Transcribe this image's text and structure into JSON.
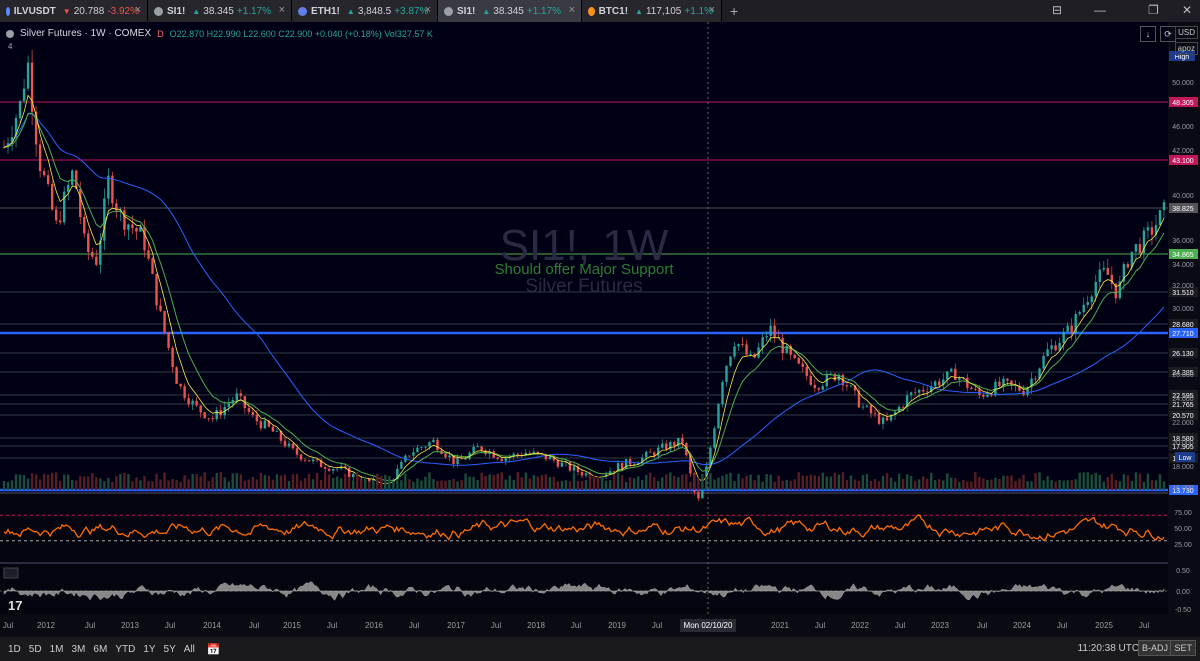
{
  "tabs": [
    {
      "symbol": "ILVUSDT",
      "price": "20.788",
      "change": "-3.92%",
      "dir": "neg",
      "icon_color": "#5a8cff",
      "icon": "ilv-coin-icon"
    },
    {
      "symbol": "SI1!",
      "price": "38.345",
      "change": "+1.17%",
      "dir": "pos",
      "icon_color": "#9aa0a6",
      "icon": "silver-icon"
    },
    {
      "symbol": "ETH1!",
      "price": "3,848.5",
      "change": "+3.87%",
      "dir": "pos",
      "icon_color": "#627eea",
      "icon": "ethereum-icon"
    },
    {
      "symbol": "SI1!",
      "price": "38.345",
      "change": "+1.17%",
      "dir": "pos",
      "icon_color": "#9aa0a6",
      "icon": "silver-icon",
      "active": true
    },
    {
      "symbol": "BTC1!",
      "price": "117,105",
      "change": "+1.1%",
      "dir": "pos",
      "icon_color": "#f7931a",
      "icon": "bitcoin-icon"
    }
  ],
  "legend": {
    "title": "Silver Futures · 1W · COMEX",
    "d": "D",
    "ohlc": "O22.870 H22.990 L22.600 C22.900 +0.040 (+0.18%) Vol327.57 K"
  },
  "indicator_count": "4",
  "currency": "USD",
  "scale_mode": "apoz",
  "watermark": {
    "symbol": "SI1!, 1W",
    "line1": "Should offer Major Support",
    "line2": "Silver Futures"
  },
  "price_axis": {
    "ticks": [
      "50.000",
      "46.000",
      "42.000",
      "40.000",
      "36.000",
      "34.000",
      "32.000",
      "30.000",
      "26.000",
      "24.000",
      "22.000",
      "20.000",
      "18.000",
      "16.000"
    ],
    "high_label": "High",
    "low_label": "Low",
    "levels": [
      {
        "label": "48.305",
        "color": "#c2185b"
      },
      {
        "label": "43.100",
        "color": "#c2185b"
      },
      {
        "label": "38.825",
        "color": "#555555"
      },
      {
        "label": "34.865",
        "color": "#4caf50"
      },
      {
        "label": "31.510",
        "color": "#263238"
      },
      {
        "label": "28.680",
        "color": "#263238"
      },
      {
        "label": "27.710",
        "color": "#2962ff"
      },
      {
        "label": "26.130",
        "color": "#263238"
      },
      {
        "label": "24.385",
        "color": "#263238"
      },
      {
        "label": "22.595",
        "color": "#263238"
      },
      {
        "label": "21.765",
        "color": "#263238"
      },
      {
        "label": "20.570",
        "color": "#263238"
      },
      {
        "label": "18.580",
        "color": "#263238"
      },
      {
        "label": "17.905",
        "color": "#263238"
      },
      {
        "label": "16.725",
        "color": "#263238"
      },
      {
        "label": "13.730",
        "color": "#2962ff"
      }
    ]
  },
  "rsi_axis": {
    "ticks": [
      "75.00",
      "50.00",
      "25.00"
    ]
  },
  "osc_axis": {
    "ticks": [
      "0.50",
      "0.00",
      "-0.50"
    ]
  },
  "time_axis": {
    "labels": [
      "Jul",
      "2012",
      "Jul",
      "2013",
      "Jul",
      "2014",
      "Jul",
      "2015",
      "Jul",
      "2016",
      "Jul",
      "2017",
      "Jul",
      "2018",
      "Jul",
      "2019",
      "Jul",
      "2021",
      "Jul",
      "2022",
      "Jul",
      "2023",
      "Jul",
      "2024",
      "Jul",
      "2025",
      "Jul"
    ],
    "crosshair_label": "Mon 02/10/20"
  },
  "bottombar": {
    "ranges": [
      "1D",
      "5D",
      "1M",
      "3M",
      "6M",
      "YTD",
      "1Y",
      "5Y",
      "All"
    ],
    "clock": "11:20:38 UTC-4",
    "badj": "B-ADJ",
    "set": "SET"
  },
  "chart_data": {
    "type": "candlestick",
    "title": "Silver Futures · 1W · COMEX",
    "ylim": [
      13.5,
      54
    ],
    "colors": {
      "up": "#26a69a",
      "down": "#ef5350",
      "ema_fast": "#ffeb3b",
      "ema_mid": "#4caf50",
      "sma_long": "#2962ff",
      "rsi": "#ff6d00"
    },
    "close_path": [
      [
        0,
        44
      ],
      [
        0.015,
        48
      ],
      [
        0.02,
        52
      ],
      [
        0.03,
        43
      ],
      [
        0.045,
        37
      ],
      [
        0.06,
        42
      ],
      [
        0.07,
        35
      ],
      [
        0.08,
        34
      ],
      [
        0.09,
        41
      ],
      [
        0.1,
        38
      ],
      [
        0.12,
        36
      ],
      [
        0.135,
        29
      ],
      [
        0.15,
        23
      ],
      [
        0.165,
        21
      ],
      [
        0.18,
        20
      ],
      [
        0.2,
        22
      ],
      [
        0.215,
        20
      ],
      [
        0.23,
        19
      ],
      [
        0.25,
        17
      ],
      [
        0.27,
        16
      ],
      [
        0.29,
        15.5
      ],
      [
        0.31,
        14.5
      ],
      [
        0.33,
        14
      ],
      [
        0.35,
        17
      ],
      [
        0.37,
        18
      ],
      [
        0.39,
        16
      ],
      [
        0.41,
        17.5
      ],
      [
        0.43,
        16.5
      ],
      [
        0.45,
        17
      ],
      [
        0.47,
        16.5
      ],
      [
        0.49,
        15.5
      ],
      [
        0.51,
        14.8
      ],
      [
        0.53,
        15.8
      ],
      [
        0.55,
        16.5
      ],
      [
        0.57,
        17.5
      ],
      [
        0.585,
        18
      ],
      [
        0.595,
        13.5
      ],
      [
        0.6,
        12.5
      ],
      [
        0.61,
        18
      ],
      [
        0.62,
        24
      ],
      [
        0.63,
        27
      ],
      [
        0.645,
        25
      ],
      [
        0.66,
        28
      ],
      [
        0.68,
        25
      ],
      [
        0.7,
        23
      ],
      [
        0.72,
        24
      ],
      [
        0.74,
        21
      ],
      [
        0.76,
        19.5
      ],
      [
        0.78,
        22
      ],
      [
        0.8,
        23
      ],
      [
        0.82,
        24
      ],
      [
        0.84,
        22
      ],
      [
        0.86,
        23
      ],
      [
        0.88,
        22.5
      ],
      [
        0.9,
        26
      ],
      [
        0.92,
        28
      ],
      [
        0.94,
        32
      ],
      [
        0.95,
        33
      ],
      [
        0.96,
        31
      ],
      [
        0.97,
        34.5
      ],
      [
        0.985,
        36
      ],
      [
        1,
        38.3
      ]
    ]
  }
}
